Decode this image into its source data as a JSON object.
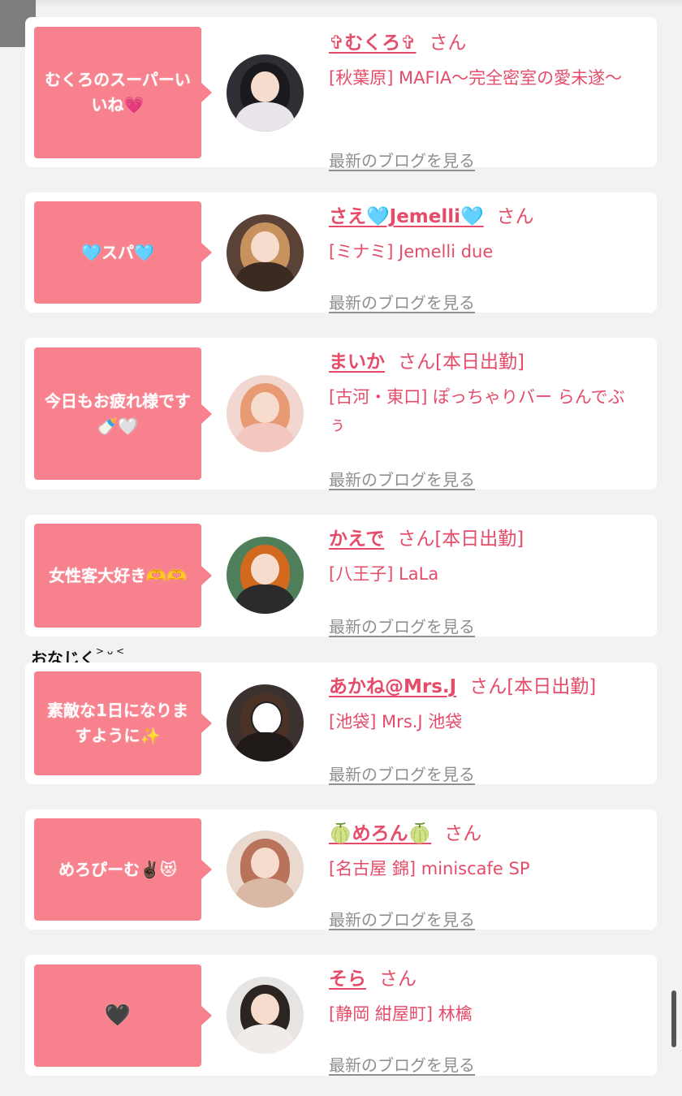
{
  "blog_link_label": "最新のブログを見る",
  "handwritten_note": "おなじく",
  "handwritten_face": "> ᴗ <",
  "colors": {
    "accent_pink": "#f7818d",
    "link_pink": "#e54c6a",
    "muted_gray": "#8f8f8f",
    "background": "#f2f2f2"
  },
  "items": [
    {
      "bubble": "むくろのスーパーいいね💗",
      "name": "✞むくろ✞",
      "honorific": "さん",
      "shop": "[秋葉原] MAFIA〜完全密室の愛未遂〜"
    },
    {
      "bubble": "🩵スパ🩵",
      "name": "さえ🩵Jemelli🩵",
      "honorific": "さん",
      "shop": "[ミナミ] Jemelli due"
    },
    {
      "bubble": "今日もお疲れ様です🍼🤍",
      "name": "まいか",
      "honorific": "さん[本日出勤]",
      "shop": "[古河・東口] ぽっちゃりバー らんでぶぅ"
    },
    {
      "bubble": "女性客大好き🫶🫶",
      "name": "かえで",
      "honorific": "さん[本日出勤]",
      "shop": "[八王子] LaLa"
    },
    {
      "bubble": "素敵な1日になりますように✨",
      "name": "あかね@Mrs.J",
      "honorific": "さん[本日出勤]",
      "shop": "[池袋] Mrs.J 池袋"
    },
    {
      "bubble": "めろぴーむ✌🏿😻",
      "name": "🍈めろん🍈",
      "honorific": "さん",
      "shop": "[名古屋 錦] miniscafe SP"
    },
    {
      "bubble": "🖤",
      "name": "そら",
      "honorific": "さん",
      "shop": "[静岡 紺屋町] 林檎"
    }
  ]
}
